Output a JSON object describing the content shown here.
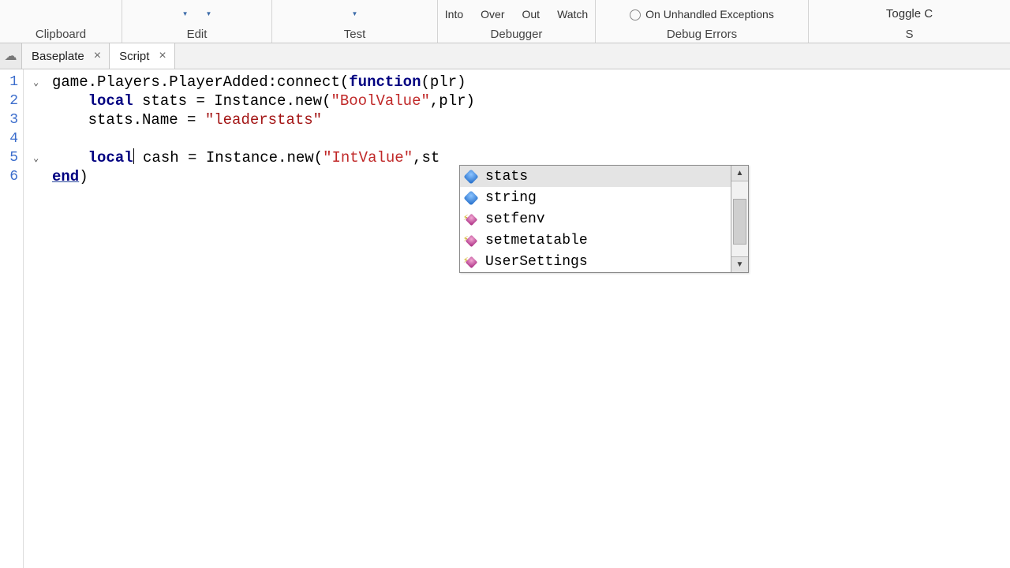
{
  "ribbon": {
    "clipboard_label": "Clipboard",
    "edit_label": "Edit",
    "test_label": "Test",
    "debugger_label": "Debugger",
    "debugger_items": [
      "Into",
      "Over",
      "Out",
      "Watch"
    ],
    "errors_label": "Debug Errors",
    "errors_option": "On Unhandled Exceptions",
    "toggle_label": "Toggle C"
  },
  "tabs": {
    "items": [
      {
        "label": "Baseplate",
        "active": false
      },
      {
        "label": "Script",
        "active": true
      }
    ]
  },
  "code": {
    "line_numbers": [
      "1",
      "2",
      "3",
      "4",
      "5",
      "6"
    ],
    "l1": {
      "a": "game.Players.PlayerAdded:connect(",
      "b": "function",
      "c": "(plr)"
    },
    "l2": {
      "a": "local",
      "b": " stats = Instance.new(",
      "c": "\"BoolValue\"",
      "d": ",plr)"
    },
    "l3": {
      "a": "    stats.Name = ",
      "b": "\"leaderstats\""
    },
    "l5": {
      "a": "local",
      "b": " cash = Instance.new(",
      "c": "\"IntValue\"",
      "d": ",st"
    },
    "l6": {
      "a": "end",
      "b": ")"
    }
  },
  "autocomplete": {
    "items": [
      {
        "label": "stats",
        "kind": "value",
        "selected": true
      },
      {
        "label": "string",
        "kind": "value",
        "selected": false
      },
      {
        "label": "setfenv",
        "kind": "function",
        "selected": false
      },
      {
        "label": "setmetatable",
        "kind": "function",
        "selected": false
      },
      {
        "label": "UserSettings",
        "kind": "function",
        "selected": false
      }
    ]
  }
}
